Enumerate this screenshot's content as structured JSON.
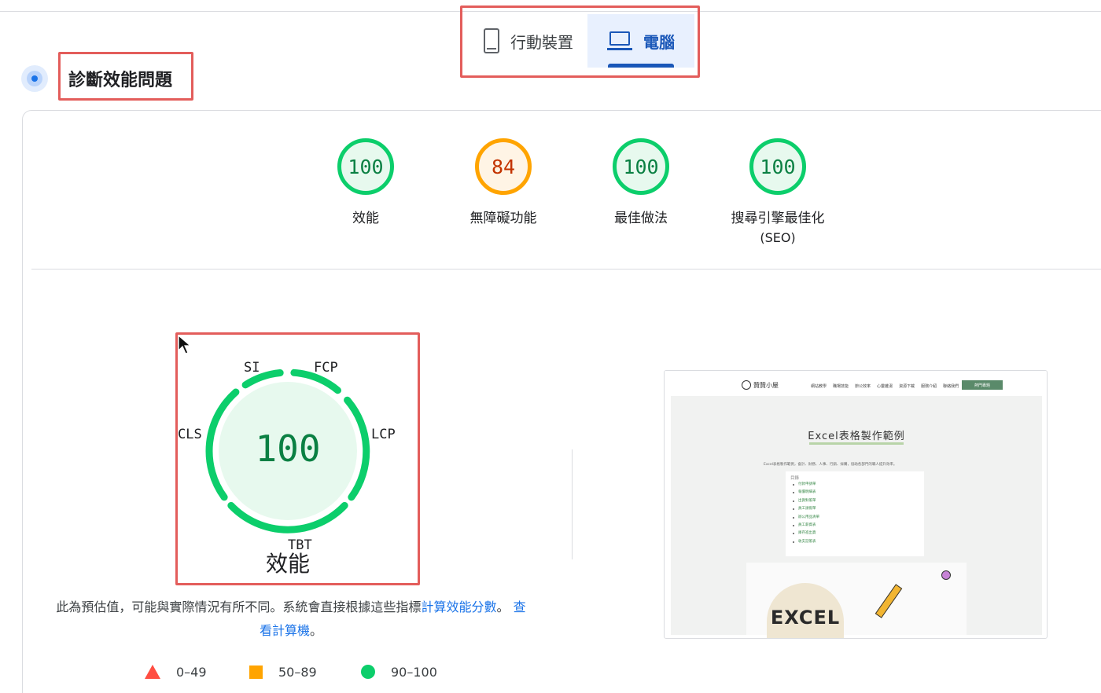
{
  "device_tabs": {
    "mobile_label": "行動裝置",
    "desktop_label": "電腦",
    "selected": "desktop"
  },
  "section": {
    "title": "診斷效能問題"
  },
  "categories": [
    {
      "score": "100",
      "label": "效能",
      "status": "pass"
    },
    {
      "score": "84",
      "label": "無障礙功能",
      "status": "average"
    },
    {
      "score": "100",
      "label": "最佳做法",
      "status": "pass"
    },
    {
      "score": "100",
      "label": "搜尋引擎最佳化",
      "sub": "(SEO)",
      "status": "pass"
    }
  ],
  "performance_gauge": {
    "score": "100",
    "label": "效能",
    "metrics": {
      "si": "SI",
      "fcp": "FCP",
      "lcp": "LCP",
      "tbt": "TBT",
      "cls": "CLS"
    }
  },
  "note": {
    "text": "此為預估值，可能與實際情況有所不同。系統會直接根據這些指標",
    "link1": "計算效能分數",
    "sep": "。",
    "link2": "查看計算機",
    "end": "。"
  },
  "legend": [
    {
      "range": "0–49",
      "shape": "triangle",
      "color": "#ff4e42"
    },
    {
      "range": "50–89",
      "shape": "square",
      "color": "#ffa400"
    },
    {
      "range": "90–100",
      "shape": "circle",
      "color": "#0cce6b"
    }
  ],
  "thumbnail": {
    "site_name": "贊贊小屋",
    "menu": [
      "網站教學",
      "職場技能",
      "辦公效率",
      "心靈雞湯",
      "資源下載",
      "服務介紹",
      "聯絡我們"
    ],
    "menu_button": "熱門專題",
    "heading": "Excel表格製作範例",
    "paragraph": "Excel表格製作範例，會計、財務、人事、行銷、採購，協助各部門的職人提升效率。",
    "toc_title": "目錄",
    "toc_items": [
      "付款申請單",
      "報價明細表",
      "出貨對帳單",
      "員工請假單",
      "辦公用品清單",
      "員工薪資表",
      "庫存進出貨",
      "收支記帳表"
    ],
    "hero_text": "EXCEL"
  },
  "colors": {
    "pass": "#0cce6b",
    "average": "#ffa400",
    "fail": "#ff4e42",
    "accent": "#1a73e8"
  }
}
